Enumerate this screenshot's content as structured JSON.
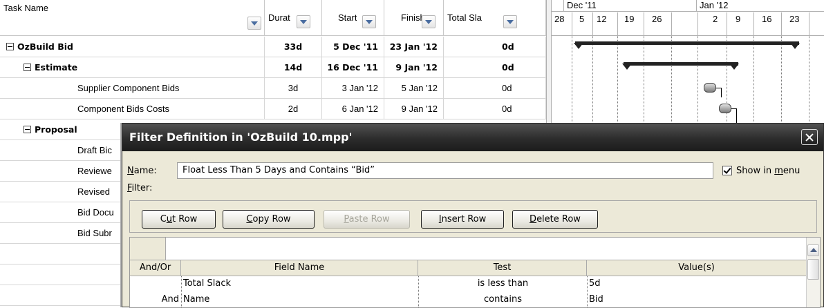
{
  "table": {
    "headers": {
      "task_name": "Task Name",
      "duration": "Durat",
      "start": "Start",
      "finish": "Finish",
      "total_slack": "Total Sla"
    },
    "rows": [
      {
        "name": "OzBuild Bid",
        "duration": "33d",
        "start": "5 Dec '11",
        "finish": "23 Jan '12",
        "slack": "0d",
        "summary": true,
        "level": 0
      },
      {
        "name": "Estimate",
        "duration": "14d",
        "start": "16 Dec '11",
        "finish": "9 Jan '12",
        "slack": "0d",
        "summary": true,
        "level": 1
      },
      {
        "name": "Supplier Component Bids",
        "duration": "3d",
        "start": "3 Jan '12",
        "finish": "5 Jan '12",
        "slack": "0d",
        "summary": false,
        "level": 2
      },
      {
        "name": "Component Bids Costs",
        "duration": "2d",
        "start": "6 Jan '12",
        "finish": "9 Jan '12",
        "slack": "0d",
        "summary": false,
        "level": 2
      },
      {
        "name": "Proposal",
        "summary": true,
        "level": 1
      },
      {
        "name": "Draft Bic",
        "summary": false,
        "level": 2
      },
      {
        "name": "Reviewe",
        "summary": false,
        "level": 2
      },
      {
        "name": "Revised",
        "summary": false,
        "level": 2
      },
      {
        "name": "Bid Docu",
        "summary": false,
        "level": 2
      },
      {
        "name": "Bid Subr",
        "summary": false,
        "level": 2
      }
    ]
  },
  "gantt": {
    "months": [
      "Dec '11",
      "Jan '12"
    ],
    "days": [
      "28",
      "5",
      "12",
      "19",
      "26",
      "2",
      "9",
      "16",
      "23"
    ]
  },
  "dialog": {
    "title": "Filter Definition in 'OzBuild 10.mpp'",
    "name_label": "Name:",
    "name_value": "Float Less Than 5 Days and Contains “Bid”",
    "show_in_menu_label": "Show in menu",
    "show_in_menu_checked": true,
    "filter_label": "Filter:",
    "buttons": {
      "cut_row": "Cut Row",
      "copy_row": "Copy Row",
      "paste_row": "Paste Row",
      "insert_row": "Insert Row",
      "delete_row": "Delete Row"
    },
    "grid": {
      "headers": [
        "And/Or",
        "Field Name",
        "Test",
        "Value(s)"
      ],
      "rows": [
        {
          "and_or": "",
          "field": "Total Slack",
          "test": "is less than",
          "value": "5d"
        },
        {
          "and_or": "And",
          "field": "Name",
          "test": "contains",
          "value": "Bid"
        }
      ]
    }
  }
}
